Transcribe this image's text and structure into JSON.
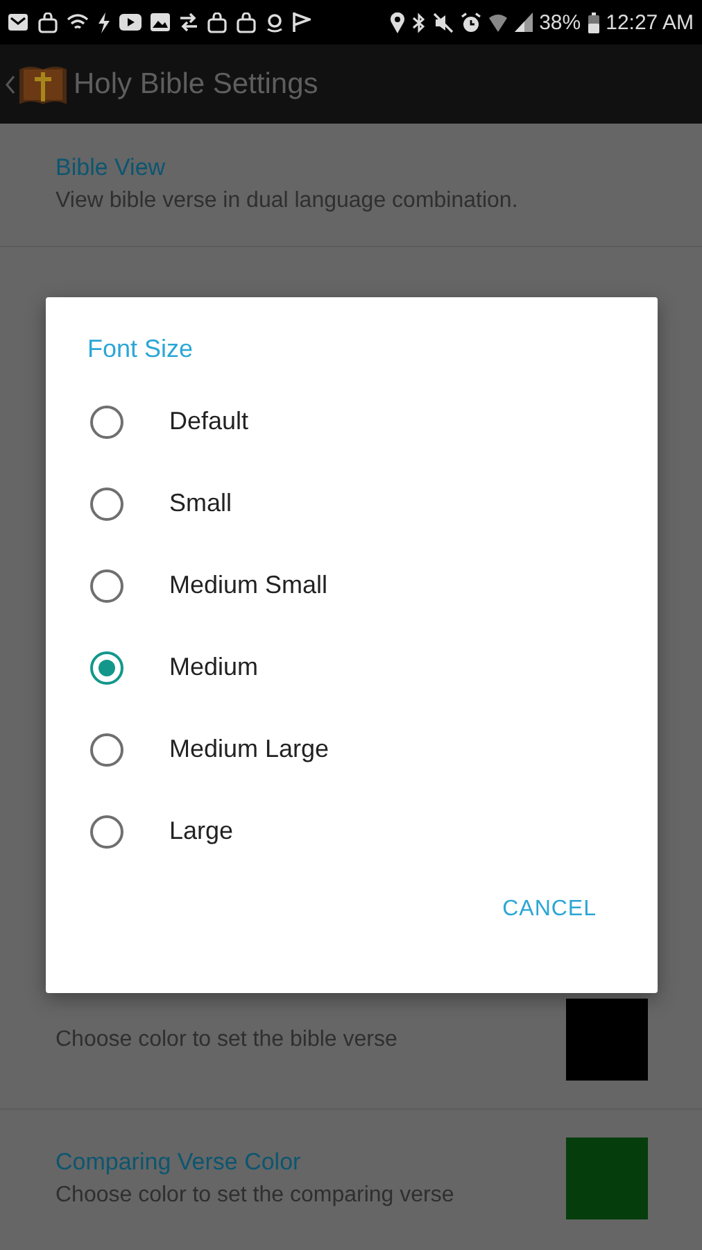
{
  "status_bar": {
    "battery": "38%",
    "time": "12:27 AM"
  },
  "action_bar": {
    "title": "Holy Bible Settings"
  },
  "settings": [
    {
      "kind": "text",
      "title": "Bible View",
      "summary": "View bible verse in dual language combination."
    },
    {
      "kind": "color",
      "summary": "Choose color to set the bible verse",
      "color": "#000000"
    },
    {
      "kind": "color",
      "title": "Comparing Verse Color",
      "summary": "Choose color to set the comparing verse",
      "color": "#063d0c"
    }
  ],
  "dialog": {
    "title": "Font Size",
    "options": [
      {
        "label": "Default",
        "selected": false
      },
      {
        "label": "Small",
        "selected": false
      },
      {
        "label": "Medium Small",
        "selected": false
      },
      {
        "label": "Medium",
        "selected": true
      },
      {
        "label": "Medium Large",
        "selected": false
      },
      {
        "label": "Large",
        "selected": false
      }
    ],
    "button": "CANCEL"
  }
}
